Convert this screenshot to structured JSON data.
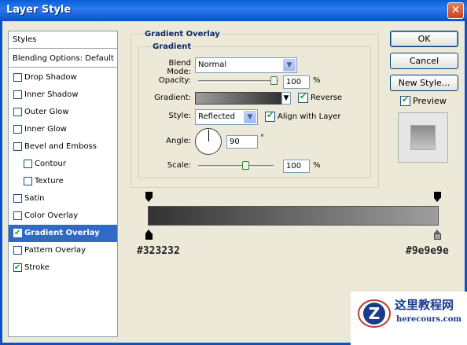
{
  "window": {
    "title": "Layer Style",
    "close": "✕"
  },
  "styles_list": {
    "header": "Styles",
    "blending": "Blending Options: Default",
    "items": [
      {
        "label": "Drop Shadow",
        "checked": false
      },
      {
        "label": "Inner Shadow",
        "checked": false
      },
      {
        "label": "Outer Glow",
        "checked": false
      },
      {
        "label": "Inner Glow",
        "checked": false
      },
      {
        "label": "Bevel and Emboss",
        "checked": false
      },
      {
        "label": "Contour",
        "checked": false
      },
      {
        "label": "Texture",
        "checked": false
      },
      {
        "label": "Satin",
        "checked": false
      },
      {
        "label": "Color Overlay",
        "checked": false
      },
      {
        "label": "Gradient Overlay",
        "checked": true
      },
      {
        "label": "Pattern Overlay",
        "checked": false
      },
      {
        "label": "Stroke",
        "checked": true
      }
    ]
  },
  "panel": {
    "title": "Gradient Overlay",
    "subtitle": "Gradient",
    "blend_mode_label": "Blend Mode:",
    "blend_mode_value": "Normal",
    "opacity_label": "Opacity:",
    "opacity_value": "100",
    "opacity_unit": "%",
    "gradient_label": "Gradient:",
    "reverse_label": "Reverse",
    "reverse_checked": true,
    "style_label": "Style:",
    "style_value": "Reflected",
    "align_label": "Align with Layer",
    "align_checked": true,
    "angle_label": "Angle:",
    "angle_value": "90",
    "angle_unit": "°",
    "scale_label": "Scale:",
    "scale_value": "100",
    "scale_unit": "%"
  },
  "buttons": {
    "ok": "OK",
    "cancel": "Cancel",
    "new_style": "New Style...",
    "preview_label": "Preview",
    "preview_checked": true
  },
  "gradient_editor": {
    "left_color": "#323232",
    "right_color": "#9e9e9e",
    "left_label": "#323232",
    "right_label": "#9e9e9e"
  },
  "watermark": {
    "main": "这里教程网",
    "sub": "herecours.com"
  }
}
